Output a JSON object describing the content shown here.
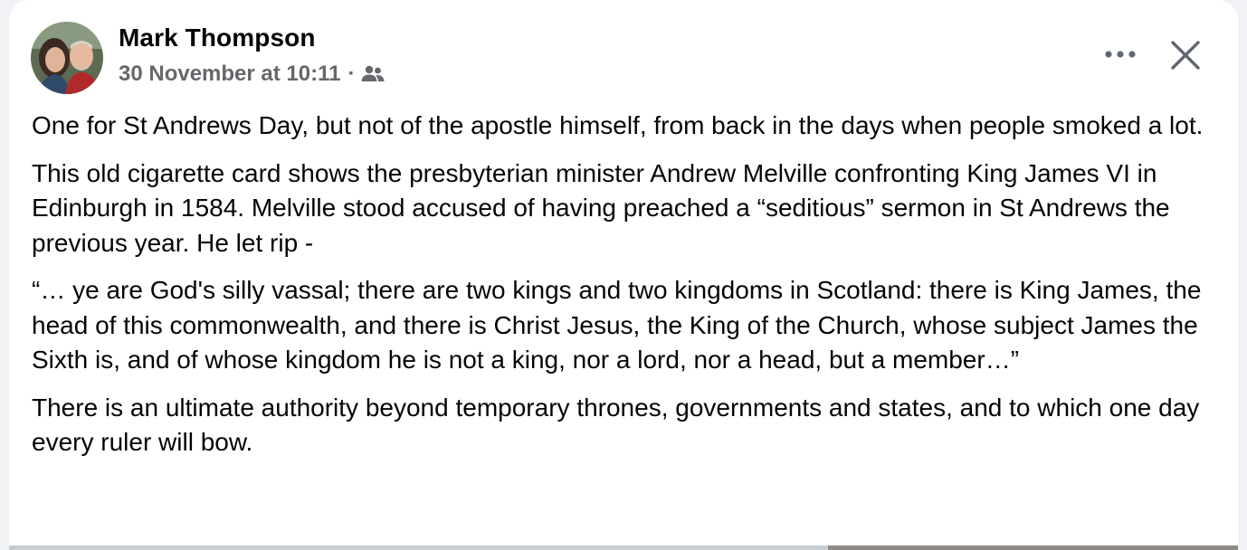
{
  "post": {
    "author": "Mark Thompson",
    "timestamp": "30 November at 10:11",
    "separator": "·",
    "audience_icon": "friends-icon",
    "actions": {
      "more_icon": "more-icon",
      "close_icon": "close-icon"
    },
    "paragraphs": [
      "One for St Andrews Day, but not of the apostle himself, from back in the days when people smoked a lot.",
      "This old cigarette card shows the presbyterian minister Andrew Melville confronting King James VI in Edinburgh in 1584. Melville stood accused of having preached a “seditious” sermon in St Andrews the previous year. He let rip -",
      "“… ye are God's silly vassal; there are two kings and two kingdoms in Scotland: there is King James, the head of this commonwealth, and there is Christ Jesus, the King of the Church, whose subject James the Sixth is, and of whose kingdom he is not a king, nor a lord, nor a head, but a member…”",
      "There is an ultimate authority beyond temporary thrones, governments and states, and to which one day every ruler will bow."
    ]
  },
  "colors": {
    "text_primary": "#050505",
    "text_secondary": "#65676b",
    "background": "#ffffff",
    "page_background": "#f0f2f5"
  }
}
